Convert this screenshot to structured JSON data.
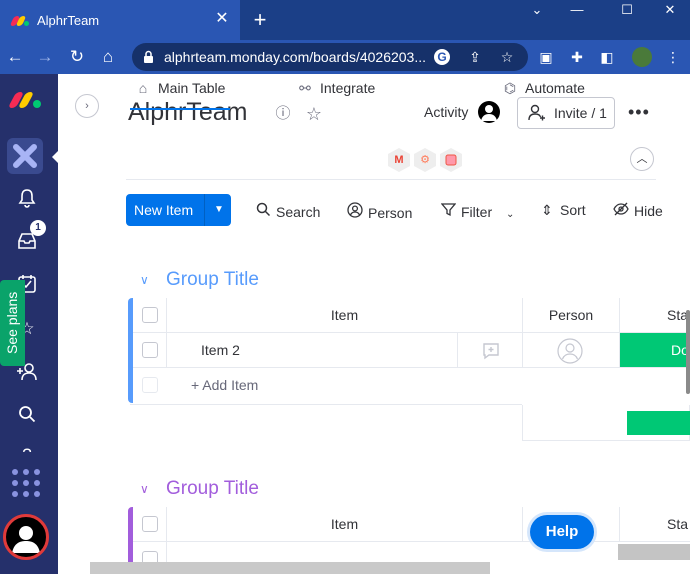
{
  "browser": {
    "tab_title": "AlphrTeam",
    "close_tab": "✕",
    "new_tab": "+",
    "url": "alphrteam.monday.com/boards/4026203...",
    "window_controls": [
      "⌄",
      "—",
      "☐",
      "✕"
    ]
  },
  "sidebar": {
    "notification_badge": "1",
    "see_plans": "See plans"
  },
  "board": {
    "title": "AlphrTeam",
    "activity_label": "Activity",
    "invite_label": "Invite / 1",
    "more_label": "•••",
    "tabs": [
      {
        "label": "Main Table"
      },
      {
        "label": "Integrate"
      },
      {
        "label": "Automate"
      }
    ],
    "new_item_label": "New Item",
    "tools": [
      {
        "label": "Search"
      },
      {
        "label": "Person"
      },
      {
        "label": "Filter"
      },
      {
        "label": "Sort"
      },
      {
        "label": "Hide"
      }
    ]
  },
  "groups": [
    {
      "title": "Group Title",
      "color": "#579bfc",
      "columns": {
        "item": "Item",
        "person": "Person",
        "status": "Sta"
      },
      "rows": [
        {
          "item": "Item 2",
          "status": "Do"
        }
      ],
      "add_item": "+ Add Item"
    },
    {
      "title": "Group Title",
      "color": "#a25ddc",
      "columns": {
        "item": "Item",
        "status": "Sta"
      }
    }
  ],
  "help_label": "Help",
  "colors": {
    "primary": "#0073ea",
    "done_green": "#00c875",
    "sidebar": "#25306b"
  }
}
